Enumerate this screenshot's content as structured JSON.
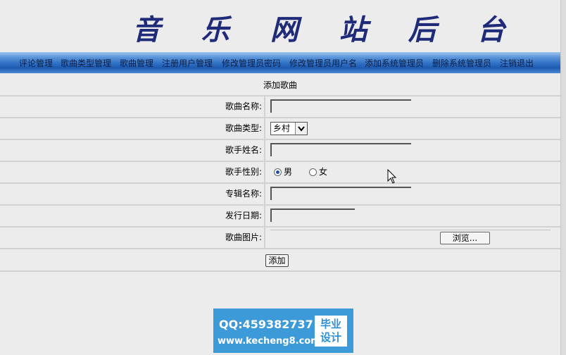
{
  "header": {
    "title": "音 乐 网 站 后 台"
  },
  "nav": {
    "items": [
      "评论管理",
      "歌曲类型管理",
      "歌曲管理",
      "注册用户管理",
      "修改管理员密码",
      "修改管理员用户名",
      "添加系统管理员",
      "删除系统管理员",
      "注销退出"
    ]
  },
  "form": {
    "title": "添加歌曲",
    "fields": {
      "song_name": {
        "label": "歌曲名称:",
        "value": ""
      },
      "song_type": {
        "label": "歌曲类型:",
        "selected": "乡村"
      },
      "singer_name": {
        "label": "歌手姓名:",
        "value": ""
      },
      "singer_gender": {
        "label": "歌手性别:",
        "options": [
          "男",
          "女"
        ],
        "selected": "男"
      },
      "album_name": {
        "label": "专辑名称:",
        "value": ""
      },
      "release_date": {
        "label": "发行日期:",
        "value": ""
      },
      "song_image": {
        "label": "歌曲图片:",
        "browse_label": "浏览..."
      }
    },
    "submit_label": "添加"
  },
  "badge": {
    "qq": "QQ:459382737",
    "site": "www.kecheng8.com",
    "tag_line1": "毕业",
    "tag_line2": "设计"
  },
  "colors": {
    "title": "#1f2a78",
    "nav": "#2e6fc4",
    "badge": "#3d9ad8"
  }
}
